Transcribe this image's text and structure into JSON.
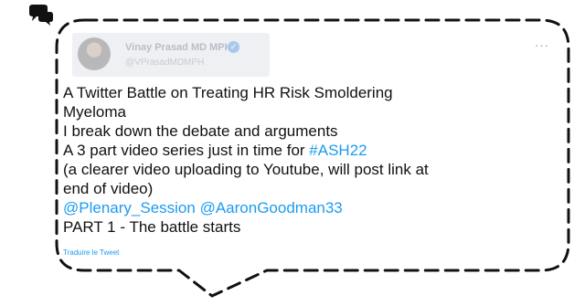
{
  "tweet": {
    "author": {
      "display_name": "Vinay Prasad MD MPH",
      "handle": "@VPrasadMDMPH"
    },
    "more_label": "···",
    "translate_label": "Traduire le Tweet",
    "body": {
      "line1": "A Twitter Battle on Treating HR Risk Smoldering",
      "line2": "Myeloma",
      "line3": "I break down the debate and arguments",
      "line4_text": "A 3 part video series just in time for ",
      "line4_hashtag": "#ASH22",
      "line5": "(a clearer video uploading to Youtube, will post link at",
      "line6": "end of video)",
      "line7_mention1": "@Plenary_Session",
      "line7_mention2": "@AaronGoodman33",
      "line8": "PART 1 - The battle starts"
    }
  },
  "colors": {
    "link": "#1d9bf0",
    "bubble_border": "#111111",
    "text": "#111111"
  },
  "icons": {
    "chat": "chat-bubbles-icon",
    "verified": "verified-badge-icon",
    "more": "more-horizontal-icon"
  }
}
